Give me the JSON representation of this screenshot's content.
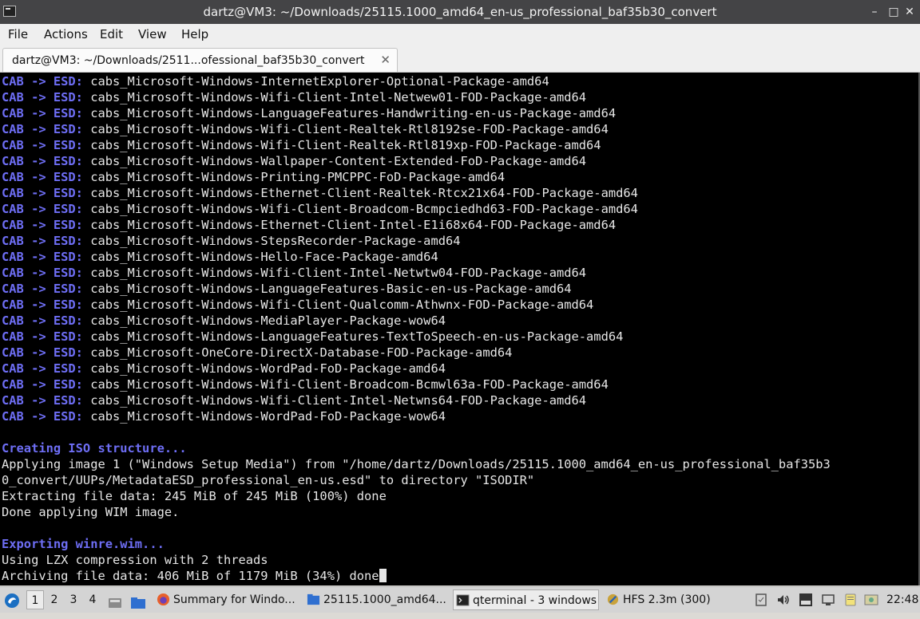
{
  "window": {
    "title": "dartz@VM3: ~/Downloads/25115.1000_amd64_en-us_professional_baf35b30_convert",
    "controls": [
      "–",
      "□",
      "✕"
    ]
  },
  "menu": [
    "File",
    "Actions",
    "Edit",
    "View",
    "Help"
  ],
  "tab": {
    "label": "dartz@VM3: ~/Downloads/2511...ofessional_baf35b30_convert",
    "close": "✕"
  },
  "terminal": {
    "cab_prefix": "CAB -> ESD:",
    "packages": [
      "cabs_Microsoft-Windows-InternetExplorer-Optional-Package-amd64",
      "cabs_Microsoft-Windows-Wifi-Client-Intel-Netwew01-FOD-Package-amd64",
      "cabs_Microsoft-Windows-LanguageFeatures-Handwriting-en-us-Package-amd64",
      "cabs_Microsoft-Windows-Wifi-Client-Realtek-Rtl8192se-FOD-Package-amd64",
      "cabs_Microsoft-Windows-Wifi-Client-Realtek-Rtl819xp-FOD-Package-amd64",
      "cabs_Microsoft-Windows-Wallpaper-Content-Extended-FoD-Package-amd64",
      "cabs_Microsoft-Windows-Printing-PMCPPC-FoD-Package-amd64",
      "cabs_Microsoft-Windows-Ethernet-Client-Realtek-Rtcx21x64-FOD-Package-amd64",
      "cabs_Microsoft-Windows-Wifi-Client-Broadcom-Bcmpciedhd63-FOD-Package-amd64",
      "cabs_Microsoft-Windows-Ethernet-Client-Intel-E1i68x64-FOD-Package-amd64",
      "cabs_Microsoft-Windows-StepsRecorder-Package-amd64",
      "cabs_Microsoft-Windows-Hello-Face-Package-amd64",
      "cabs_Microsoft-Windows-Wifi-Client-Intel-Netwtw04-FOD-Package-amd64",
      "cabs_Microsoft-Windows-LanguageFeatures-Basic-en-us-Package-amd64",
      "cabs_Microsoft-Windows-Wifi-Client-Qualcomm-Athwnx-FOD-Package-amd64",
      "cabs_Microsoft-Windows-MediaPlayer-Package-wow64",
      "cabs_Microsoft-Windows-LanguageFeatures-TextToSpeech-en-us-Package-amd64",
      "cabs_Microsoft-OneCore-DirectX-Database-FOD-Package-amd64",
      "cabs_Microsoft-Windows-WordPad-FoD-Package-amd64",
      "cabs_Microsoft-Windows-Wifi-Client-Broadcom-Bcmwl63a-FOD-Package-amd64",
      "cabs_Microsoft-Windows-Wifi-Client-Intel-Netwns64-FOD-Package-amd64",
      "cabs_Microsoft-Windows-WordPad-FoD-Package-wow64"
    ],
    "iso_heading": "Creating ISO structure...",
    "iso_lines": [
      "Applying image 1 (\"Windows Setup Media\") from \"/home/dartz/Downloads/25115.1000_amd64_en-us_professional_baf35b3",
      "0_convert/UUPs/MetadataESD_professional_en-us.esd\" to directory \"ISODIR\"",
      "Extracting file data: 245 MiB of 245 MiB (100%) done",
      "Done applying WIM image."
    ],
    "winre_heading": "Exporting winre.wim...",
    "winre_lines": [
      "Using LZX compression with 2 threads",
      "Archiving file data: 406 MiB of 1179 MiB (34%) done"
    ]
  },
  "taskbar": {
    "workspaces": [
      "1",
      "2",
      "3",
      "4"
    ],
    "active_workspace": "1",
    "tasks": [
      {
        "label": "Summary for Windo...",
        "icon": "firefox-icon"
      },
      {
        "label": "25115.1000_amd64...",
        "icon": "folder-icon"
      },
      {
        "label": "qterminal - 3 windows",
        "icon": "terminal-icon",
        "active": true
      },
      {
        "label": "HFS 2.3m (300)",
        "icon": "hfs-icon"
      }
    ],
    "clock": "22:48"
  },
  "colors": {
    "accent_blue": "#6e6ef5",
    "terminal_bg": "#000000",
    "terminal_fg": "#e6e6e6",
    "titlebar_bg": "#444446"
  }
}
